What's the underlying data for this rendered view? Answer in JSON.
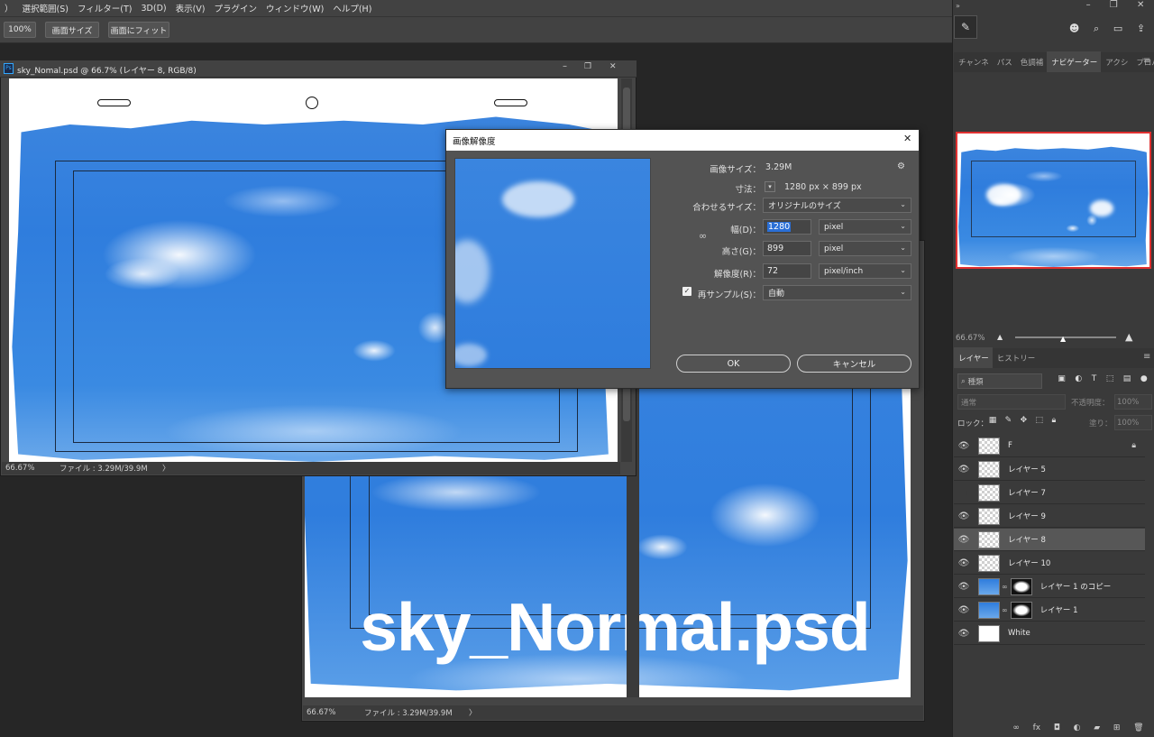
{
  "menu": [
    "）",
    "選択範囲(S)",
    "フィルター(T)",
    "3D(D)",
    "表示(V)",
    "プラグイン",
    "ウィンドウ(W)",
    "ヘルプ(H)"
  ],
  "options": {
    "zoom": "100%",
    "fit_screen": "画面サイズ",
    "fill_screen": "画面にフィット"
  },
  "doc1": {
    "title": "sky_Nomal.psd @ 66.7% (レイヤー 8, RGB/8)",
    "zoom": "66.67%",
    "file_info": "ファイル : 3.29M/39.9M",
    "arrow": "〉"
  },
  "doc2": {
    "zoom": "66.67%",
    "file_info": "ファイル : 3.29M/39.9M",
    "arrow": "〉",
    "overlay_text": "sky_Normal.psd"
  },
  "dialog": {
    "title": "画像解像度",
    "image_size_label": "画像サイズ：",
    "image_size_value": "3.29M",
    "dimensions_label": "寸法：",
    "dimensions_value": "1280 px × 899 px",
    "fit_label": "合わせるサイズ：",
    "fit_value": "オリジナルのサイズ",
    "width_label": "幅(D)：",
    "width_value": "1280",
    "width_unit": "pixel",
    "height_label": "高さ(G)：",
    "height_value": "899",
    "height_unit": "pixel",
    "resolution_label": "解像度(R)：",
    "resolution_value": "72",
    "resolution_unit": "pixel/inch",
    "resample_label": "再サンプル(S)：",
    "resample_value": "自動",
    "ok": "OK",
    "cancel": "キャンセル"
  },
  "panels": {
    "top_tabs": [
      "チャンネ",
      "パス",
      "色調補",
      "ナビゲーター",
      "アクシ",
      "プロパ"
    ],
    "active_top_tab": "ナビゲーター",
    "nav_zoom": "66.67%",
    "layer_tabs": [
      "レイヤー",
      "ヒストリー"
    ],
    "search_placeholder": "種類",
    "blend_mode": "通常",
    "opacity_label": "不透明度：",
    "opacity_value": "100%",
    "lock_label": "ロック：",
    "fill_label": "塗り：",
    "fill_value": "100%"
  },
  "layers": [
    {
      "name": "F",
      "thumb": "checker",
      "visible": true,
      "locked": true
    },
    {
      "name": "レイヤー 5",
      "thumb": "checker",
      "visible": true
    },
    {
      "name": "レイヤー 7",
      "thumb": "checker",
      "visible": false
    },
    {
      "name": "レイヤー 9",
      "thumb": "checker",
      "visible": true
    },
    {
      "name": "レイヤー 8",
      "thumb": "checker",
      "visible": true,
      "selected": true
    },
    {
      "name": "レイヤー 10",
      "thumb": "checker",
      "visible": true
    },
    {
      "name": "レイヤー 1 のコピー",
      "thumb": "blue",
      "visible": true,
      "mask": true
    },
    {
      "name": "レイヤー 1",
      "thumb": "blue",
      "visible": true,
      "mask": true
    },
    {
      "name": "White",
      "thumb": "white",
      "visible": true
    }
  ],
  "colors": {
    "ui_bg": "#424242",
    "sky_blue": "#2f7ddd",
    "selection": "#575757",
    "nav_frame": "#e03030"
  }
}
